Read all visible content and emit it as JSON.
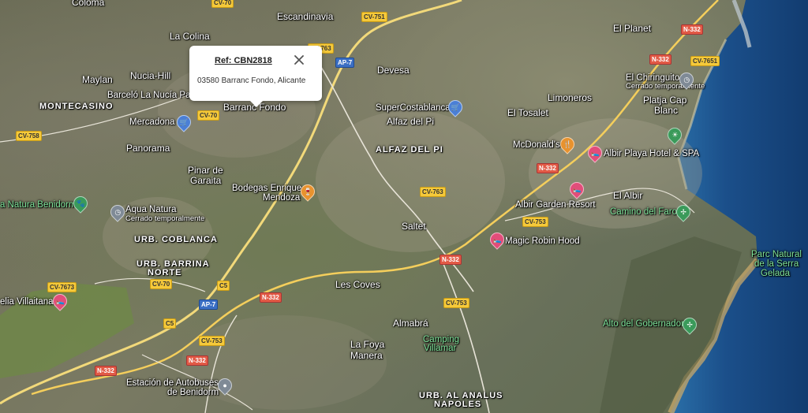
{
  "popup": {
    "ref": "Ref: CBN2818",
    "address": "03580 Barranc Fondo, Alicante",
    "close_icon": "close-icon"
  },
  "places": [
    {
      "id": "coloma",
      "text": "Coloma"
    },
    {
      "id": "la-colina",
      "text": "La Colina"
    },
    {
      "id": "escandinavia",
      "text": "Escandinavia"
    },
    {
      "id": "maylan",
      "text": "Maylan"
    },
    {
      "id": "nucia-hill",
      "text": "Nucia-Hill"
    },
    {
      "id": "barcelo",
      "text": "Barceló La Nucía Pal"
    },
    {
      "id": "montecasino",
      "text": "MONTECASINO"
    },
    {
      "id": "mercadona",
      "text": "Mercadona"
    },
    {
      "id": "barranc-fondo",
      "text": "Barranc Fondo"
    },
    {
      "id": "devesa",
      "text": "Devesa"
    },
    {
      "id": "supercostablanca",
      "text": "SuperCostablanca"
    },
    {
      "id": "alfaz",
      "text": "Alfaz del Pi"
    },
    {
      "id": "alfaz-area",
      "text": "ALFAZ DEL PI"
    },
    {
      "id": "el-tosalet",
      "text": "El Tosalet"
    },
    {
      "id": "limoneros",
      "text": "Limoneros"
    },
    {
      "id": "el-planet",
      "text": "El Planet"
    },
    {
      "id": "el-chiringuito",
      "text": "El Chiringuito"
    },
    {
      "id": "cerrado-chiringuito",
      "text": "Cerrado temporalmente"
    },
    {
      "id": "platja",
      "text": "Platja Cap"
    },
    {
      "id": "blanc",
      "text": "Blanc"
    },
    {
      "id": "panorama",
      "text": "Panorama"
    },
    {
      "id": "pinar",
      "text": "Pinar de"
    },
    {
      "id": "garaita",
      "text": "Garaita"
    },
    {
      "id": "bodegas",
      "text": "Bodegas Enrique"
    },
    {
      "id": "mendoza",
      "text": "Mendoza"
    },
    {
      "id": "mcdonalds",
      "text": "McDonald's"
    },
    {
      "id": "albir-playa",
      "text": "Albir Playa Hotel & SPA"
    },
    {
      "id": "natura-benidorm",
      "text": "a Natura Benidorm"
    },
    {
      "id": "aqua-natura",
      "text": "Aqua Natura"
    },
    {
      "id": "cerrado-aqua",
      "text": "Cerrado temporalmente"
    },
    {
      "id": "el-albir",
      "text": "El Albir"
    },
    {
      "id": "albir-garden",
      "text": "Albir Garden Resort"
    },
    {
      "id": "camino-faro",
      "text": "Camino del Faro"
    },
    {
      "id": "saltet",
      "text": "Saltet"
    },
    {
      "id": "urb-coblanca",
      "text": "URB. COBLANCA"
    },
    {
      "id": "urb-barrina",
      "text": "URB. BARRINA"
    },
    {
      "id": "norte",
      "text": "NORTE"
    },
    {
      "id": "magic-robin",
      "text": "Magic Robin Hood"
    },
    {
      "id": "parc-natural",
      "text": "Parc Natural"
    },
    {
      "id": "serra",
      "text": "de la Serra"
    },
    {
      "id": "gelada",
      "text": "Gelada"
    },
    {
      "id": "les-coves",
      "text": "Les Coves"
    },
    {
      "id": "villaitana",
      "text": "elia Villaitana"
    },
    {
      "id": "almabra",
      "text": "Almabrá"
    },
    {
      "id": "alto-gobernador",
      "text": "Alto del Gobernador"
    },
    {
      "id": "la-foya",
      "text": "La Foya"
    },
    {
      "id": "manera",
      "text": "Manera"
    },
    {
      "id": "camping",
      "text": "Camping"
    },
    {
      "id": "villamar",
      "text": "Villamar"
    },
    {
      "id": "estacion",
      "text": "Estación de Autobuses"
    },
    {
      "id": "de-benidorm",
      "text": "de Benidorm"
    },
    {
      "id": "urb-al-analus",
      "text": "URB. AL ANALUS"
    },
    {
      "id": "napoles",
      "text": "NAPOLES"
    }
  ],
  "roads": [
    {
      "id": "cv70-top",
      "text": "CV-70",
      "color": "yellow"
    },
    {
      "id": "cv751",
      "text": "CV-751",
      "color": "yellow"
    },
    {
      "id": "cv763-a",
      "text": "CV-763",
      "color": "yellow"
    },
    {
      "id": "ap7-top",
      "text": "AP-7",
      "color": "blue"
    },
    {
      "id": "n332-tr",
      "text": "N-332",
      "color": "red"
    },
    {
      "id": "n332-b",
      "text": "N-332",
      "color": "red"
    },
    {
      "id": "cv7651",
      "text": "CV-7651",
      "color": "yellow"
    },
    {
      "id": "cv70-mid",
      "text": "CV-70",
      "color": "yellow"
    },
    {
      "id": "cv758",
      "text": "CV-758",
      "color": "yellow"
    },
    {
      "id": "n332-c",
      "text": "N-332",
      "color": "red"
    },
    {
      "id": "cv763-b",
      "text": "CV-763",
      "color": "yellow"
    },
    {
      "id": "cv753-a",
      "text": "CV-753",
      "color": "yellow"
    },
    {
      "id": "n332-d",
      "text": "N-332",
      "color": "red"
    },
    {
      "id": "cv7673",
      "text": "CV-7673",
      "color": "yellow"
    },
    {
      "id": "cv70-low",
      "text": "CV-70",
      "color": "yellow"
    },
    {
      "id": "c5-a",
      "text": "C5",
      "color": "yellow"
    },
    {
      "id": "n332-e",
      "text": "N-332",
      "color": "red"
    },
    {
      "id": "cv753-b",
      "text": "CV-753",
      "color": "yellow"
    },
    {
      "id": "ap7-low",
      "text": "AP-7",
      "color": "blue"
    },
    {
      "id": "c5-b",
      "text": "C5",
      "color": "yellow"
    },
    {
      "id": "cv753-c",
      "text": "CV-753",
      "color": "yellow"
    },
    {
      "id": "n332-f",
      "text": "N-332",
      "color": "red"
    },
    {
      "id": "n332-g",
      "text": "N-332",
      "color": "red"
    }
  ],
  "pins": [
    {
      "id": "mercadona-pin",
      "icon": "shopping-cart-icon",
      "color": "#4a7fd6"
    },
    {
      "id": "supercostablanca-pin",
      "icon": "shopping-cart-icon",
      "color": "#4a7fd6"
    },
    {
      "id": "bodegas-pin",
      "icon": "wine-glass-icon",
      "color": "#e8922e"
    },
    {
      "id": "mcdonalds-pin",
      "icon": "fork-knife-icon",
      "color": "#e8922e"
    },
    {
      "id": "albir-playa-pin",
      "icon": "bed-icon",
      "color": "#e24d7a"
    },
    {
      "id": "albir-garden-pin",
      "icon": "bed-icon",
      "color": "#e24d7a"
    },
    {
      "id": "magic-robin-pin",
      "icon": "bed-icon",
      "color": "#e24d7a"
    },
    {
      "id": "villaitana-pin",
      "icon": "bed-icon",
      "color": "#e24d7a"
    },
    {
      "id": "natura-pin",
      "icon": "paw-icon",
      "color": "#3a9a5a"
    },
    {
      "id": "aqua-natura-pin",
      "icon": "clock-closed-icon",
      "color": "#7f8a96"
    },
    {
      "id": "chiringuito-pin",
      "icon": "clock-closed-icon",
      "color": "#7f8a96"
    },
    {
      "id": "estacion-pin",
      "icon": "location-pin-icon",
      "color": "#7f8a96"
    },
    {
      "id": "camino-faro-pin",
      "icon": "hiking-icon",
      "color": "#3a9a5a"
    },
    {
      "id": "alto-gobernador-pin",
      "icon": "hiking-icon",
      "color": "#3a9a5a"
    },
    {
      "id": "platja-pin",
      "icon": "beach-icon",
      "color": "#3a9a5a"
    }
  ],
  "colors": {
    "sea": "#1b4f8a",
    "road_major": "#f2d97a",
    "road_minor": "#e8e4d8"
  }
}
